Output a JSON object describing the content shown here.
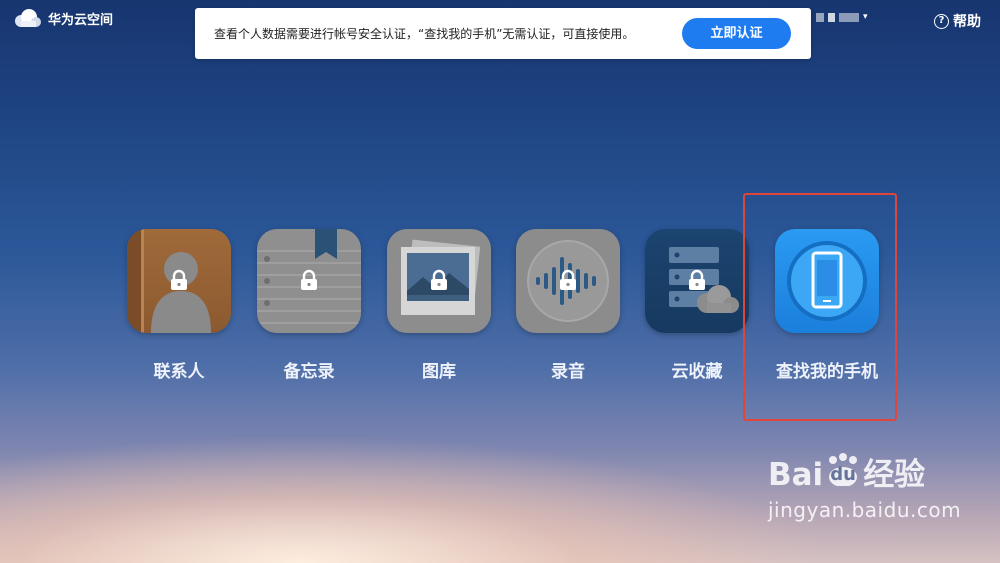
{
  "header": {
    "app_name": "华为云空间",
    "user_caret": "▾",
    "help_icon_glyph": "?",
    "help_label": "帮助"
  },
  "notice": {
    "message": "查看个人数据需要进行帐号安全认证，“查找我的手机”无需认证，可直接使用。",
    "button_label": "立即认证"
  },
  "apps": [
    {
      "id": "contacts",
      "label": "联系人",
      "icon": "contacts-book-icon",
      "locked": true
    },
    {
      "id": "notes",
      "label": "备忘录",
      "icon": "notebook-icon",
      "locked": true
    },
    {
      "id": "gallery",
      "label": "图库",
      "icon": "photo-gallery-icon",
      "locked": true
    },
    {
      "id": "recordings",
      "label": "录音",
      "icon": "sound-wave-icon",
      "locked": true
    },
    {
      "id": "favorites",
      "label": "云收藏",
      "icon": "cloud-favorites-icon",
      "locked": true
    },
    {
      "id": "find-phone",
      "label": "查找我的手机",
      "icon": "phone-icon",
      "locked": false,
      "highlighted": true
    }
  ],
  "watermark": {
    "brand_left": "Bai",
    "brand_mid": "du",
    "brand_right": "经验",
    "url": "jingyan.baidu.com"
  },
  "colors": {
    "accent": "#1e7cf0",
    "highlight_border": "#e0453a"
  }
}
